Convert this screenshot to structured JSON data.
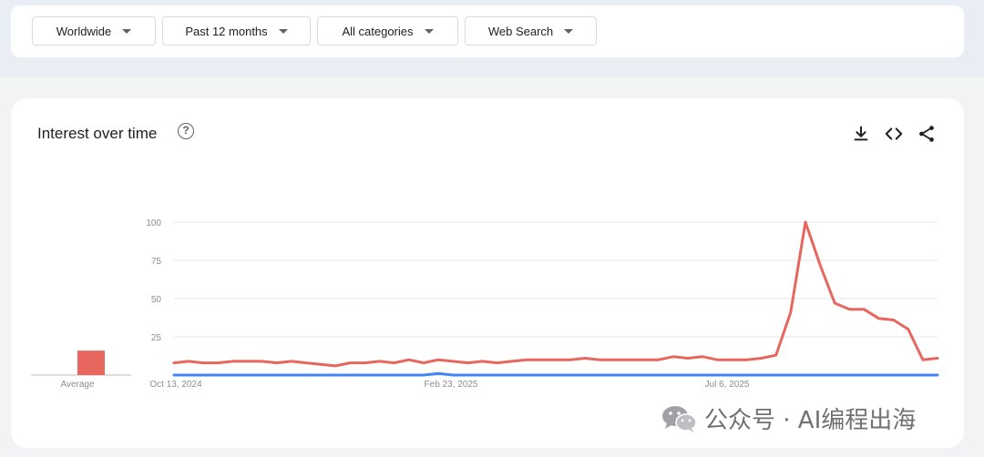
{
  "filters": {
    "region": "Worldwide",
    "time_range": "Past 12 months",
    "category": "All categories",
    "search_type": "Web Search"
  },
  "card": {
    "title": "Interest over time",
    "help_icon": "help-circle-icon",
    "tools": [
      "download-icon",
      "embed-code-icon",
      "share-icon"
    ]
  },
  "watermark": "公众号 · AI编程出海",
  "colors": {
    "series_red": "#e7675e",
    "series_blue": "#4285f4",
    "grid": "#e6e6e6"
  },
  "chart_data": {
    "type": "line",
    "ylim": [
      0,
      100
    ],
    "y_ticks": [
      "100",
      "75",
      "50",
      "25"
    ],
    "x_tick_labels": [
      "Oct 13, 2024",
      "Feb 23, 2025",
      "Jul 6, 2025"
    ],
    "average_label": "Average",
    "series": [
      {
        "color": "#e7675e",
        "average": 16,
        "values": [
          8,
          9,
          8,
          8,
          9,
          9,
          9,
          8,
          9,
          8,
          7,
          6,
          8,
          8,
          9,
          8,
          10,
          8,
          10,
          9,
          8,
          9,
          8,
          9,
          10,
          10,
          10,
          10,
          11,
          10,
          10,
          10,
          10,
          10,
          12,
          11,
          12,
          10,
          10,
          10,
          11,
          13,
          41,
          100,
          72,
          47,
          43,
          43,
          37,
          36,
          30,
          10,
          11
        ]
      },
      {
        "color": "#4285f4",
        "average": 0,
        "values": [
          0,
          0,
          0,
          0,
          0,
          0,
          0,
          0,
          0,
          0,
          0,
          0,
          0,
          0,
          0,
          0,
          0,
          0,
          1,
          0,
          0,
          0,
          0,
          0,
          0,
          0,
          0,
          0,
          0,
          0,
          0,
          0,
          0,
          0,
          0,
          0,
          0,
          0,
          0,
          0,
          0,
          0,
          0,
          0,
          0,
          0,
          0,
          0,
          0,
          0,
          0,
          0,
          0
        ]
      }
    ]
  }
}
